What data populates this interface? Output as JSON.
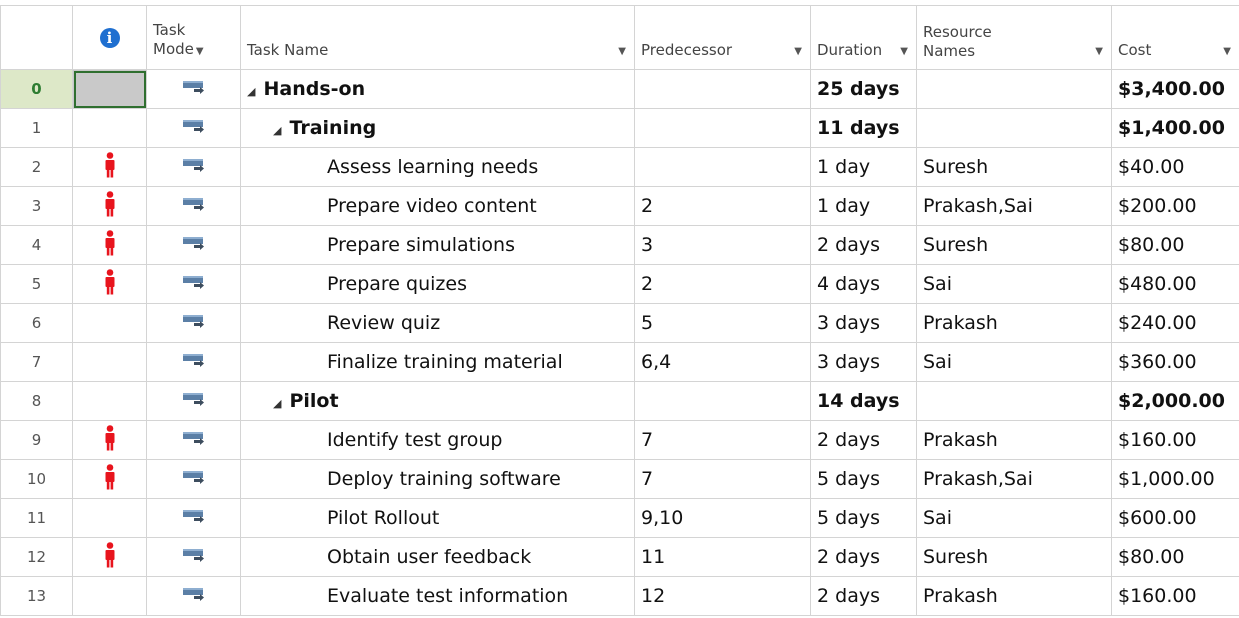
{
  "header": {
    "info_tooltip": "i",
    "task_mode": [
      "Task",
      "Mode"
    ],
    "task_name": "Task Name",
    "predecessor": "Predecessor",
    "duration": "Duration",
    "resource_names": [
      "Resource",
      "Names"
    ],
    "cost": "Cost"
  },
  "colors": {
    "info": "#1f6fd0",
    "person": "#e8141d",
    "mode_icon": "#5b7fa6",
    "selection_border": "#2f6f2f"
  },
  "rows": [
    {
      "id": "0",
      "indicator": "",
      "name": "Hands-on",
      "predecessor": "",
      "duration": "25 days",
      "resources": "",
      "cost": "$3,400.00"
    },
    {
      "id": "1",
      "indicator": "",
      "name": "Training",
      "predecessor": "",
      "duration": "11 days",
      "resources": "",
      "cost": "$1,400.00"
    },
    {
      "id": "2",
      "indicator": "person-icon",
      "name": "Assess learning needs",
      "predecessor": "",
      "duration": "1 day",
      "resources": "Suresh",
      "cost": "$40.00"
    },
    {
      "id": "3",
      "indicator": "person-icon",
      "name": "Prepare video content",
      "predecessor": "2",
      "duration": "1 day",
      "resources": "Prakash,Sai",
      "cost": "$200.00"
    },
    {
      "id": "4",
      "indicator": "person-icon",
      "name": "Prepare simulations",
      "predecessor": "3",
      "duration": "2 days",
      "resources": "Suresh",
      "cost": "$80.00"
    },
    {
      "id": "5",
      "indicator": "person-icon",
      "name": "Prepare quizes",
      "predecessor": "2",
      "duration": "4 days",
      "resources": "Sai",
      "cost": "$480.00"
    },
    {
      "id": "6",
      "indicator": "",
      "name": "Review quiz",
      "predecessor": "5",
      "duration": "3 days",
      "resources": "Prakash",
      "cost": "$240.00"
    },
    {
      "id": "7",
      "indicator": "",
      "name": "Finalize training material",
      "predecessor": "6,4",
      "duration": "3 days",
      "resources": "Sai",
      "cost": "$360.00"
    },
    {
      "id": "8",
      "indicator": "",
      "name": "Pilot",
      "predecessor": "",
      "duration": "14 days",
      "resources": "",
      "cost": "$2,000.00"
    },
    {
      "id": "9",
      "indicator": "person-icon",
      "name": "Identify test group",
      "predecessor": "7",
      "duration": "2 days",
      "resources": "Prakash",
      "cost": "$160.00"
    },
    {
      "id": "10",
      "indicator": "person-icon",
      "name": "Deploy training software",
      "predecessor": "7",
      "duration": "5 days",
      "resources": "Prakash,Sai",
      "cost": "$1,000.00"
    },
    {
      "id": "11",
      "indicator": "",
      "name": "Pilot Rollout",
      "predecessor": "9,10",
      "duration": "5 days",
      "resources": "Sai",
      "cost": "$600.00"
    },
    {
      "id": "12",
      "indicator": "person-icon",
      "name": "Obtain user feedback",
      "predecessor": "11",
      "duration": "2 days",
      "resources": "Suresh",
      "cost": "$80.00"
    },
    {
      "id": "13",
      "indicator": "",
      "name": "Evaluate test information",
      "predecessor": "12",
      "duration": "2 days",
      "resources": "Prakash",
      "cost": "$160.00"
    }
  ]
}
